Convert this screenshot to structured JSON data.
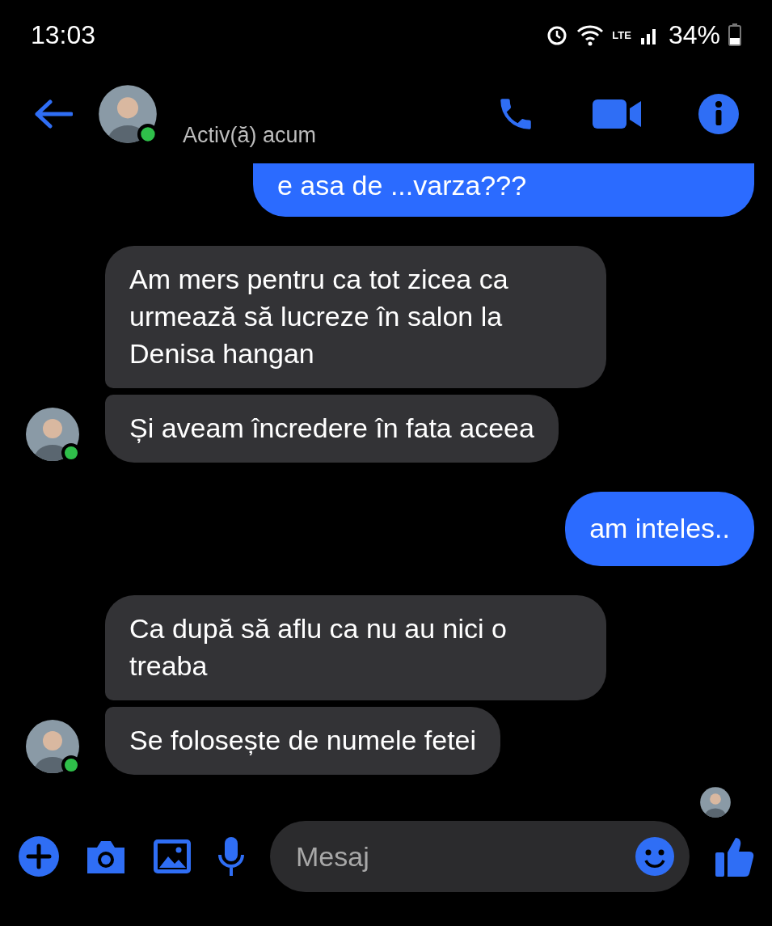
{
  "status_bar": {
    "time": "13:03",
    "network": "LTE",
    "battery": "34%"
  },
  "header": {
    "status": "Activ(ă) acum"
  },
  "messages": [
    {
      "kind": "sent",
      "text": "e asa de ...varza???"
    },
    {
      "kind": "received",
      "text": "Am mers pentru ca tot zicea ca urmează să lucreze în salon la Denisa hangan",
      "avatar": false
    },
    {
      "kind": "received",
      "text": "Și aveam încredere în fata aceea",
      "avatar": true
    },
    {
      "kind": "sent",
      "text": "am inteles.."
    },
    {
      "kind": "received",
      "text": "Ca după să aflu ca nu au nici o treaba",
      "avatar": false
    },
    {
      "kind": "received",
      "text": "Se folosește de numele fetei",
      "avatar": true
    },
    {
      "kind": "seen"
    }
  ],
  "composer": {
    "placeholder": "Mesaj"
  }
}
